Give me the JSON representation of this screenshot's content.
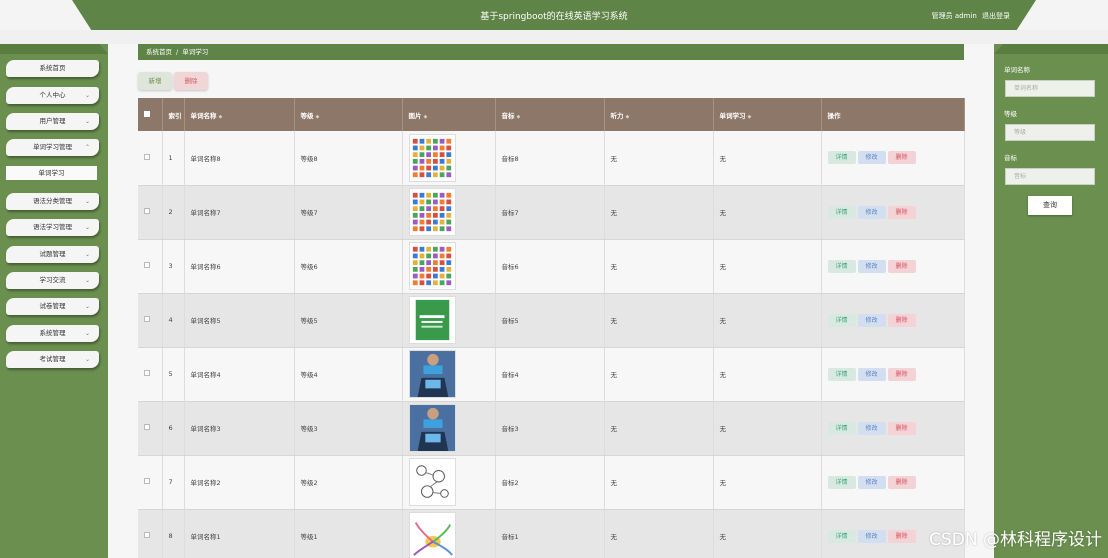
{
  "header": {
    "title": "基于springboot的在线英语学习系统",
    "user_role": "管理员 admin",
    "logout": "退出登录"
  },
  "sidebar": {
    "items": [
      {
        "label": "系统首页",
        "expand": false
      },
      {
        "label": "个人中心",
        "expand": true
      },
      {
        "label": "用户管理",
        "expand": true
      },
      {
        "label": "单词学习管理",
        "expand": true
      },
      {
        "label": "语法分类管理",
        "expand": true
      },
      {
        "label": "语法学习管理",
        "expand": true
      },
      {
        "label": "试题管理",
        "expand": true
      },
      {
        "label": "学习交流",
        "expand": true
      },
      {
        "label": "试卷管理",
        "expand": true
      },
      {
        "label": "系统管理",
        "expand": true
      },
      {
        "label": "考试管理",
        "expand": true
      }
    ],
    "submenu": "单词学习"
  },
  "breadcrumb": {
    "home": "系统首页",
    "sep": "/",
    "current": "单词学习"
  },
  "toolbar": {
    "add": "新增",
    "delete": "删除"
  },
  "table": {
    "headers": {
      "index": "索引",
      "word_name": "单词名称",
      "level": "等级",
      "image": "图片",
      "phonetic": "音标",
      "listening": "听力",
      "word_study": "单词学习",
      "action": "操作"
    },
    "actions": {
      "detail": "详情",
      "edit": "修改",
      "delete": "删除"
    },
    "rows": [
      {
        "index": "1",
        "word_name": "单词名称8",
        "level": "等级8",
        "image": "grid",
        "phonetic": "音标8",
        "listening": "无",
        "word_study": "无"
      },
      {
        "index": "2",
        "word_name": "单词名称7",
        "level": "等级7",
        "image": "grid",
        "phonetic": "音标7",
        "listening": "无",
        "word_study": "无"
      },
      {
        "index": "3",
        "word_name": "单词名称6",
        "level": "等级6",
        "image": "grid",
        "phonetic": "音标6",
        "listening": "无",
        "word_study": "无"
      },
      {
        "index": "4",
        "word_name": "单词名称5",
        "level": "等级5",
        "image": "book",
        "phonetic": "音标5",
        "listening": "无",
        "word_study": "无"
      },
      {
        "index": "5",
        "word_name": "单词名称4",
        "level": "等级4",
        "image": "person",
        "phonetic": "音标4",
        "listening": "无",
        "word_study": "无"
      },
      {
        "index": "6",
        "word_name": "单词名称3",
        "level": "等级3",
        "image": "person",
        "phonetic": "音标3",
        "listening": "无",
        "word_study": "无"
      },
      {
        "index": "7",
        "word_name": "单词名称2",
        "level": "等级2",
        "image": "sketch",
        "phonetic": "音标2",
        "listening": "无",
        "word_study": "无"
      },
      {
        "index": "8",
        "word_name": "单词名称1",
        "level": "等级1",
        "image": "mindmap",
        "phonetic": "音标1",
        "listening": "无",
        "word_study": "无"
      }
    ]
  },
  "search": {
    "word_label": "单词名称",
    "word_placeholder": "单词名称",
    "level_label": "等级",
    "level_placeholder": "等级",
    "phonetic_label": "音标",
    "phonetic_placeholder": "音标",
    "button": "查询"
  },
  "watermark": "CSDN @林科程序设计",
  "colors": {
    "primary": "#5f8447",
    "sidebar": "#6a8f4e",
    "table_header": "#8d7768",
    "detail": "#3aa37a",
    "edit": "#5a82c0",
    "delete": "#d6505e"
  }
}
